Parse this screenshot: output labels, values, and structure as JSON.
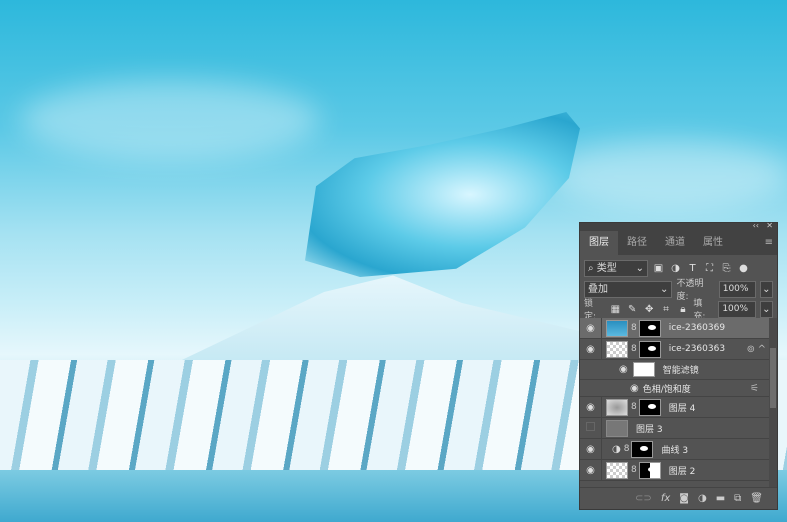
{
  "panel": {
    "tabs": [
      "图层",
      "路径",
      "通道",
      "属性"
    ],
    "filter_kind": "类型",
    "blend_mode": "叠加",
    "opacity_label": "不透明度:",
    "opacity_value": "100%",
    "lock_label": "锁定:",
    "fill_label": "填充:",
    "fill_value": "100%",
    "layers": [
      {
        "name": "ice-2360369",
        "visible": true,
        "selected": true
      },
      {
        "name": "ice-2360363",
        "visible": true
      },
      {
        "name": "智能滤镜",
        "visible": true
      },
      {
        "name": "色相/饱和度",
        "visible": true
      },
      {
        "name": "图层 4",
        "visible": true
      },
      {
        "name": "图层 3",
        "visible": false
      },
      {
        "name": "曲线 3",
        "visible": true
      },
      {
        "name": "图层 2",
        "visible": true
      }
    ],
    "bottom_icons": [
      "link-icon",
      "fx-icon",
      "mask-icon",
      "adjustment-icon",
      "folder-icon",
      "new-layer-icon",
      "trash-icon"
    ]
  }
}
